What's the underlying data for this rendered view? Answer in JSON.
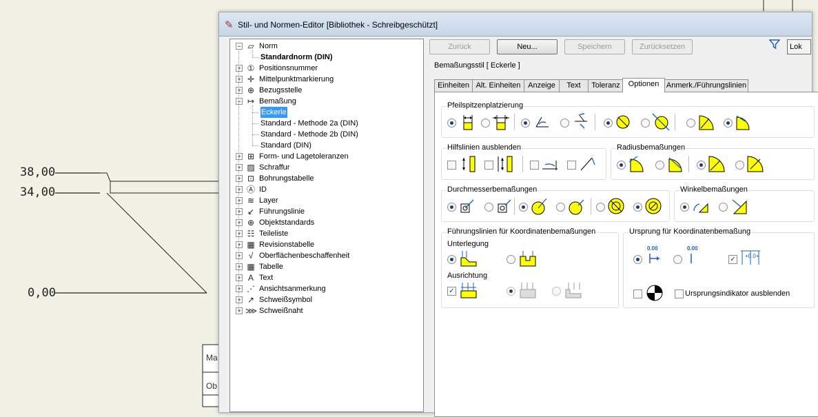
{
  "drawing": {
    "dim_labels": [
      "38,00",
      "34,00",
      "0,00"
    ],
    "title_block": [
      "Ma",
      "Ob"
    ]
  },
  "dialog": {
    "title": "Stil- und Normen-Editor [Bibliothek - Schreibgeschützt]",
    "tree": [
      {
        "label": "Norm",
        "expander": "−",
        "icon": "norm-icon",
        "glyph": "▱"
      },
      {
        "label": "Standardnorm (DIN)",
        "bold": true
      },
      {
        "label": "Positionsnummer",
        "expander": "+",
        "icon": "balloon-icon",
        "glyph": "①"
      },
      {
        "label": "Mittelpunktmarkierung",
        "expander": "+",
        "icon": "centermark-icon",
        "glyph": "✛"
      },
      {
        "label": "Bezugsstelle",
        "expander": "+",
        "icon": "datum-icon",
        "glyph": "⊕"
      },
      {
        "label": "Bemaßung",
        "expander": "−",
        "icon": "dimension-icon",
        "glyph": "↦"
      },
      {
        "label": "Eckerle",
        "selected": true
      },
      {
        "label": "Standard - Methode 2a (DIN)"
      },
      {
        "label": "Standard - Methode 2b (DIN)"
      },
      {
        "label": "Standard (DIN)"
      },
      {
        "label": "Form- und Lagetoleranzen",
        "expander": "+",
        "icon": "tolerance-icon",
        "glyph": "⊞"
      },
      {
        "label": "Schraffur",
        "expander": "+",
        "icon": "hatch-icon",
        "glyph": "▨"
      },
      {
        "label": "Bohrungstabelle",
        "expander": "+",
        "icon": "holetable-icon",
        "glyph": "⊡"
      },
      {
        "label": "ID",
        "expander": "+",
        "icon": "id-icon",
        "glyph": "Ⓐ"
      },
      {
        "label": "Layer",
        "expander": "+",
        "icon": "layer-icon",
        "glyph": "≋"
      },
      {
        "label": "Führungslinie",
        "expander": "+",
        "icon": "leader-icon",
        "glyph": "↙"
      },
      {
        "label": "Objektstandards",
        "expander": "+",
        "icon": "globe-icon",
        "glyph": "⊕"
      },
      {
        "label": "Teileliste",
        "expander": "+",
        "icon": "partslist-icon",
        "glyph": "☷"
      },
      {
        "label": "Revisionstabelle",
        "expander": "+",
        "icon": "revision-icon",
        "glyph": "▦"
      },
      {
        "label": "Oberflächenbeschaffenheit",
        "expander": "+",
        "icon": "surface-icon",
        "glyph": "√"
      },
      {
        "label": "Tabelle",
        "expander": "+",
        "icon": "table-icon",
        "glyph": "▦"
      },
      {
        "label": "Text",
        "expander": "+",
        "icon": "text-icon",
        "glyph": "A"
      },
      {
        "label": "Ansichtsanmerkung",
        "expander": "+",
        "icon": "viewnote-icon",
        "glyph": "⋰"
      },
      {
        "label": "Schweißsymbol",
        "expander": "+",
        "icon": "weldsymbol-icon",
        "glyph": "↗"
      },
      {
        "label": "Schweißnaht",
        "expander": "+",
        "icon": "weldbead-icon",
        "glyph": "⋙"
      }
    ],
    "buttons": {
      "back": "Zurück",
      "new": "Neu...",
      "save": "Speichern",
      "reset": "Zurücksetzen",
      "lok": "Lok"
    },
    "style_title": "Bemaßungsstil [ Eckerle ]",
    "tabs": [
      "Einheiten",
      "Alt. Einheiten",
      "Anzeige",
      "Text",
      "Toleranz",
      "Optionen",
      "Anmerk./Führungslinien"
    ],
    "active_tab": 5,
    "groups": {
      "arrowhead": "Pfeilspitzenplatzierung",
      "hide_ext": "Hilfslinien ausblenden",
      "radius": "Radiusbemaßungen",
      "diameter": "Durchmesserbemaßungen",
      "angle": "Winkelbemaßungen",
      "ordinate_leaders": "Führungslinien für Koordinatenbemaßungen",
      "ordinate_origin": "Ursprung für Koordinatenbemaßung"
    },
    "sub": {
      "underlay": "Unterlegung",
      "alignment": "Ausrichtung",
      "origin_value": "0.00"
    },
    "hide_origin_label": "Ursprungsindikator ausblenden",
    "colors": {
      "symbol_fill": "#ffff00",
      "accent_blue": "#1a62b8",
      "selection": "#3399ff"
    }
  }
}
